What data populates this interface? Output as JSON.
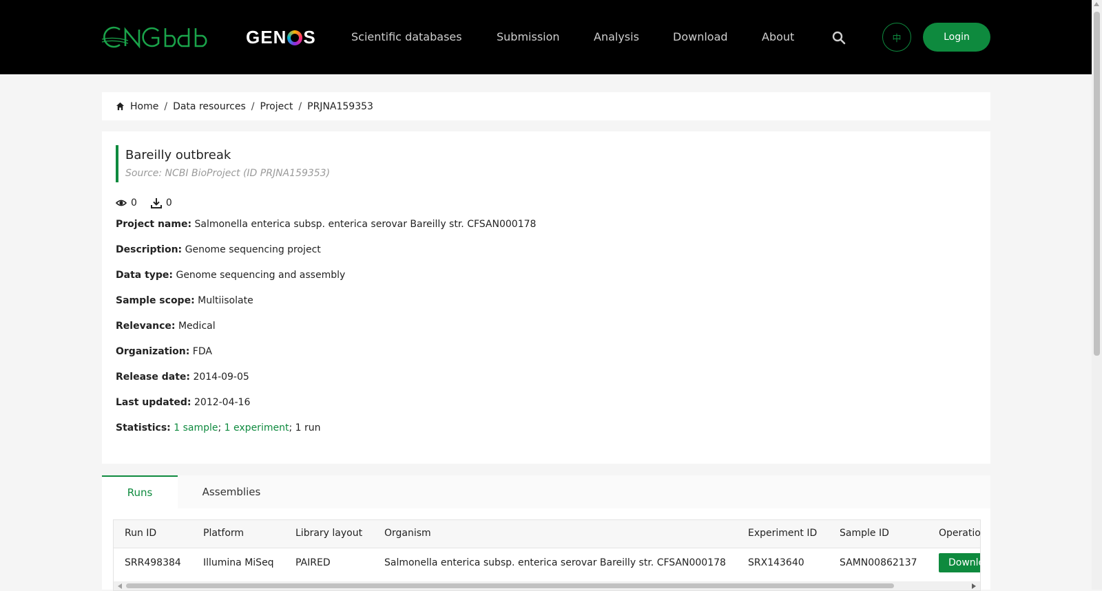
{
  "header": {
    "logo_text": "CNGBdb",
    "genos_before": "GEN",
    "genos_after": "S",
    "nav": [
      "Scientific databases",
      "Submission",
      "Analysis",
      "Download",
      "About"
    ],
    "lang_label": "中",
    "login_label": "Login"
  },
  "breadcrumb": {
    "home": "Home",
    "items": [
      "Data resources",
      "Project",
      "PRJNA159353"
    ],
    "sep": "/"
  },
  "project": {
    "title": "Bareilly outbreak",
    "source": "Source: NCBI BioProject (ID PRJNA159353)",
    "views": "0",
    "downloads": "0",
    "fields": [
      {
        "label": "Project name:",
        "value": "Salmonella enterica subsp. enterica serovar Bareilly str. CFSAN000178"
      },
      {
        "label": "Description:",
        "value": "Genome sequencing project"
      },
      {
        "label": "Data type:",
        "value": "Genome sequencing and assembly"
      },
      {
        "label": "Sample scope:",
        "value": "Multiisolate"
      },
      {
        "label": "Relevance:",
        "value": "Medical"
      },
      {
        "label": "Organization:",
        "value": "FDA"
      },
      {
        "label": "Release date:",
        "value": "2014-09-05"
      },
      {
        "label": "Last updated:",
        "value": "2012-04-16"
      }
    ],
    "statistics": {
      "label": "Statistics:",
      "sample_link": "1 sample",
      "semi1": ";",
      "experiment_link": "1 experiment",
      "run_text": "; 1 run"
    }
  },
  "tabs": [
    "Runs",
    "Assemblies"
  ],
  "table": {
    "headers": [
      "Run ID",
      "Platform",
      "Library layout",
      "Organism",
      "Experiment ID",
      "Sample ID",
      "Operation"
    ],
    "rows": [
      {
        "run_id": "SRR498384",
        "platform": "Illumina MiSeq",
        "layout": "PAIRED",
        "organism": "Salmonella enterica subsp. enterica serovar Bareilly str. CFSAN000178",
        "experiment_id": "SRX143640",
        "sample_id": "SAMN00862137",
        "operation": "Download"
      }
    ]
  },
  "colors": {
    "accent": "#0e8a3e",
    "header_bg": "#000000",
    "page_bg": "#f5f5f5"
  }
}
